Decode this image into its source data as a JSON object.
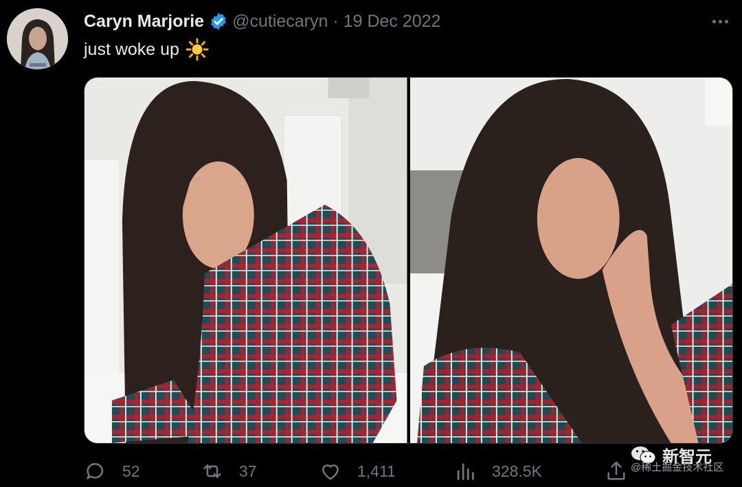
{
  "tweet": {
    "display_name": "Caryn Marjorie",
    "handle": "@cutiecaryn",
    "separator": "·",
    "date": "19 Dec 2022",
    "text": "just woke up",
    "emoji": "sun"
  },
  "actions": {
    "replies": "52",
    "retweets": "37",
    "likes": "1,411",
    "views": "328.5K"
  },
  "watermark": {
    "logo_text": "新智元",
    "sub_text": "@稀土掘金技术社区"
  },
  "colors": {
    "background": "#000000",
    "text_primary": "#e7e9ea",
    "text_secondary": "#71767b",
    "verified": "#1d9bf0"
  }
}
